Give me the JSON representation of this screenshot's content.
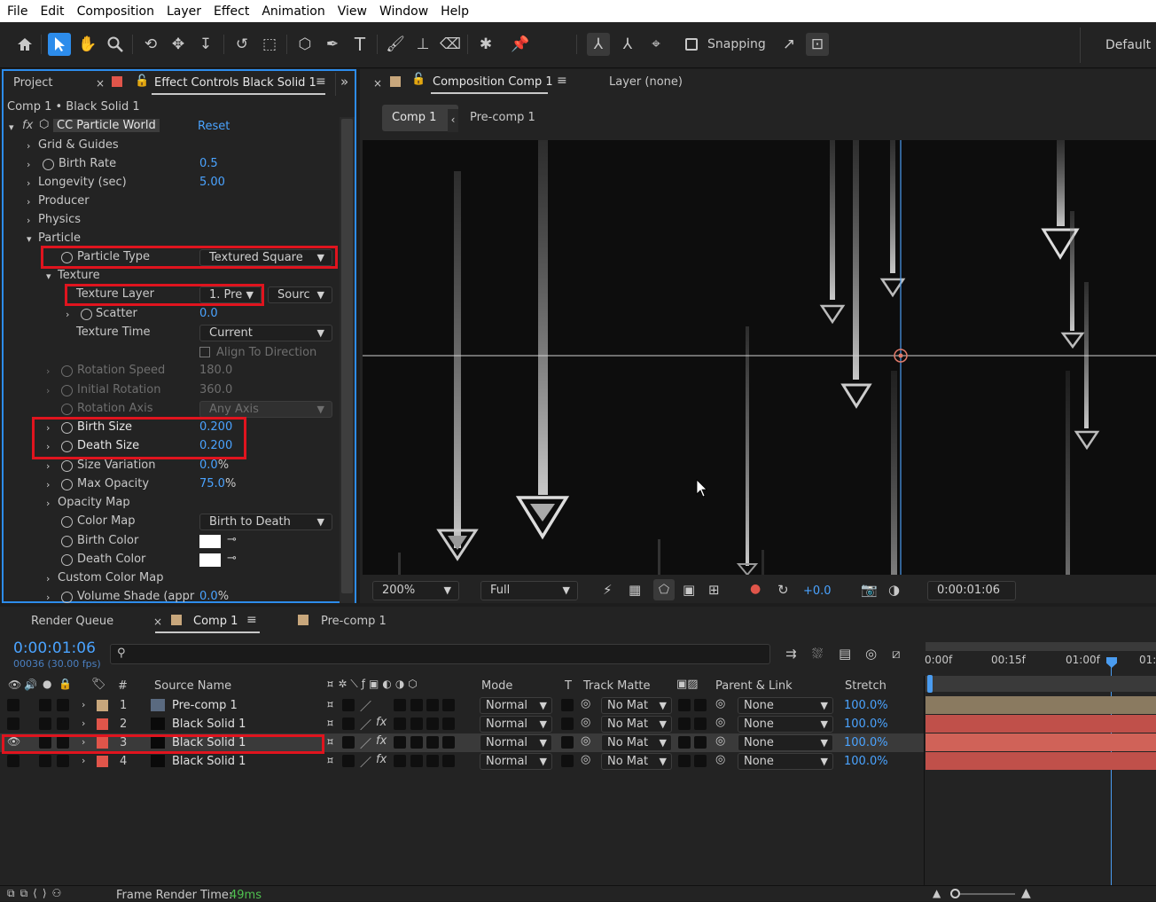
{
  "menu": [
    "File",
    "Edit",
    "Composition",
    "Layer",
    "Effect",
    "Animation",
    "View",
    "Window",
    "Help"
  ],
  "toolbar": {
    "snapping_label": "Snapping",
    "workspace_label": "Default"
  },
  "effect_panel": {
    "tab_project": "Project",
    "tab_effect_controls": "Effect Controls Black Solid 1",
    "breadcrumb": "Comp 1 • Black Solid 1",
    "effect_name": "CC Particle World",
    "reset_label": "Reset",
    "props": {
      "grid_guides": "Grid & Guides",
      "birth_rate": "Birth Rate",
      "birth_rate_val": "0.5",
      "longevity": "Longevity (sec)",
      "longevity_val": "5.00",
      "producer": "Producer",
      "physics": "Physics",
      "particle": "Particle",
      "particle_type": "Particle Type",
      "particle_type_val": "Textured Square",
      "texture": "Texture",
      "texture_layer": "Texture Layer",
      "texture_layer_val": "1. Pre",
      "texture_layer_src": "Sourc",
      "scatter": "Scatter",
      "scatter_val": "0.0",
      "texture_time": "Texture Time",
      "texture_time_val": "Current",
      "align_dir": "Align To Direction",
      "rot_speed": "Rotation Speed",
      "rot_speed_val": "180.0",
      "init_rot": "Initial Rotation",
      "init_rot_val": "360.0",
      "rot_axis": "Rotation Axis",
      "rot_axis_val": "Any Axis",
      "birth_size": "Birth Size",
      "birth_size_val": "0.200",
      "death_size": "Death Size",
      "death_size_val": "0.200",
      "size_var": "Size Variation",
      "size_var_num": "0.0",
      "size_var_unit": "%",
      "max_opacity": "Max Opacity",
      "max_opacity_num": "75.0",
      "max_opacity_unit": "%",
      "opacity_map": "Opacity Map",
      "color_map": "Color Map",
      "color_map_val": "Birth to Death",
      "birth_color": "Birth Color",
      "death_color": "Death Color",
      "custom_color_map": "Custom Color Map",
      "volume_shade": "Volume Shade (appr",
      "volume_shade_num": "0.0",
      "volume_shade_unit": "%"
    }
  },
  "comp_panel": {
    "tab_comp": "Composition Comp 1",
    "tab_layer": "Layer (none)",
    "crumb_comp1": "Comp 1",
    "crumb_precomp": "Pre-comp 1",
    "zoom": "200%",
    "quality": "Full",
    "exposure": "+0.0",
    "timecode": "0:00:01:06"
  },
  "timeline": {
    "tab_render": "Render Queue",
    "tab_comp1": "Comp 1",
    "tab_precomp": "Pre-comp 1",
    "current_time": "0:00:01:06",
    "frames": "00036 (30.00 fps)",
    "search_placeholder": "",
    "headers": {
      "num": "#",
      "source": "Source Name",
      "mode": "Mode",
      "t": "T",
      "track_matte": "Track Matte",
      "parent": "Parent & Link",
      "stretch": "Stretch"
    },
    "ruler": [
      "0:00f",
      "00:15f",
      "01:00f",
      "01:"
    ],
    "layers": [
      {
        "num": "1",
        "name": "Pre-comp 1",
        "mode": "Normal",
        "matte": "No Mat",
        "parent": "None",
        "stretch": "100.0%",
        "color": "#c8a77c"
      },
      {
        "num": "2",
        "name": "Black Solid 1",
        "mode": "Normal",
        "matte": "No Mat",
        "parent": "None",
        "stretch": "100.0%",
        "color": "#e0554a"
      },
      {
        "num": "3",
        "name": "Black Solid 1",
        "mode": "Normal",
        "matte": "No Mat",
        "parent": "None",
        "stretch": "100.0%",
        "color": "#e0554a"
      },
      {
        "num": "4",
        "name": "Black Solid 1",
        "mode": "Normal",
        "matte": "No Mat",
        "parent": "None",
        "stretch": "100.0%",
        "color": "#e0554a"
      }
    ],
    "footer_label": "Frame Render Time:",
    "footer_value": "49ms"
  },
  "colors": {
    "accent": "#2d8ceb",
    "value_blue": "#4aa3ff",
    "highlight_red": "#e0141e",
    "layer_red": "#c0504a",
    "precomp_tan": "#8a7a60"
  }
}
